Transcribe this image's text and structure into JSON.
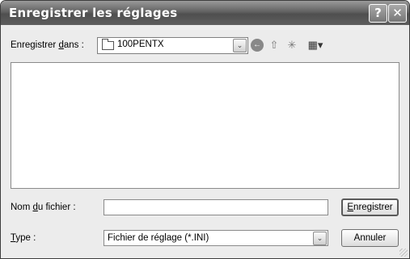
{
  "window": {
    "title": "Enregistrer les réglages",
    "help_glyph": "?",
    "close_glyph": "✕"
  },
  "location": {
    "label_pre": "Enregistrer ",
    "label_mnemonic": "d",
    "label_post": "ans :",
    "folder": "100PENTX",
    "dropdown_glyph": "⌄"
  },
  "toolbar": {
    "back_glyph": "←",
    "up_glyph": "⇧",
    "newfolder_glyph": "✳",
    "views_glyph": "▦▾"
  },
  "filename": {
    "label_pre": "Nom ",
    "label_mnemonic": "d",
    "label_post": "u fichier :",
    "value": ""
  },
  "filetype": {
    "label_mnemonic": "T",
    "label_post": "ype :",
    "value": "Fichier de réglage (*.INI)",
    "dropdown_glyph": "⌄"
  },
  "buttons": {
    "save_mnemonic": "E",
    "save_post": "nregistrer",
    "cancel": "Annuler"
  }
}
